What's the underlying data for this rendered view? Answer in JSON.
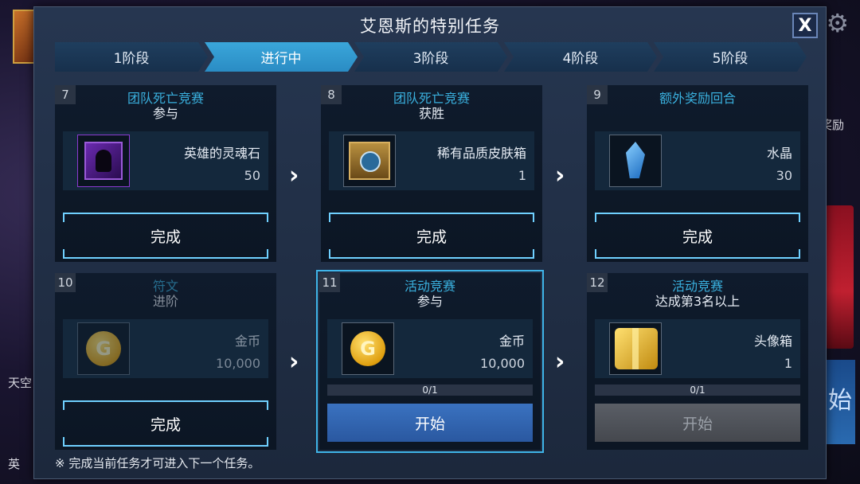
{
  "background": {
    "left_texts": [
      "天空",
      "英"
    ],
    "right_texts": [
      "奖励",
      "始"
    ],
    "settings_icon": "gear-icon"
  },
  "modal": {
    "title": "艾恩斯的特别任务",
    "close_label": "X"
  },
  "stages": [
    {
      "label": "1阶段",
      "active": false
    },
    {
      "label": "进行中",
      "active": true
    },
    {
      "label": "3阶段",
      "active": false
    },
    {
      "label": "4阶段",
      "active": false
    },
    {
      "label": "5阶段",
      "active": false
    }
  ],
  "cards": [
    {
      "num": "7",
      "title": "团队死亡竞赛",
      "subtitle": "参与",
      "reward_name": "英雄的灵魂石",
      "reward_qty": "50",
      "icon": "soul-stone-icon",
      "button": "完成",
      "state": "done"
    },
    {
      "num": "8",
      "title": "团队死亡竞赛",
      "subtitle": "获胜",
      "reward_name": "稀有品质皮肤箱",
      "reward_qty": "1",
      "icon": "skin-box-icon",
      "button": "完成",
      "state": "done"
    },
    {
      "num": "9",
      "title": "额外奖励回合",
      "subtitle": "",
      "reward_name": "水晶",
      "reward_qty": "30",
      "icon": "crystal-icon",
      "button": "完成",
      "state": "done"
    },
    {
      "num": "10",
      "title": "符文",
      "subtitle": "进阶",
      "reward_name": "金币",
      "reward_qty": "10,000",
      "icon": "gold-coin-icon",
      "button": "完成",
      "state": "done"
    },
    {
      "num": "11",
      "title": "活动竞赛",
      "subtitle": "参与",
      "reward_name": "金币",
      "reward_qty": "10,000",
      "icon": "gold-coin-icon",
      "progress": "0/1",
      "button": "开始",
      "state": "current"
    },
    {
      "num": "12",
      "title": "活动竞赛",
      "subtitle": "达成第3名以上",
      "reward_name": "头像箱",
      "reward_qty": "1",
      "icon": "avatar-box-icon",
      "progress": "0/1",
      "button": "开始",
      "state": "locked"
    }
  ],
  "coin_letter": "G",
  "arrow_glyph": "›",
  "footnote": "※ 完成当前任务才可进入下一个任务。"
}
